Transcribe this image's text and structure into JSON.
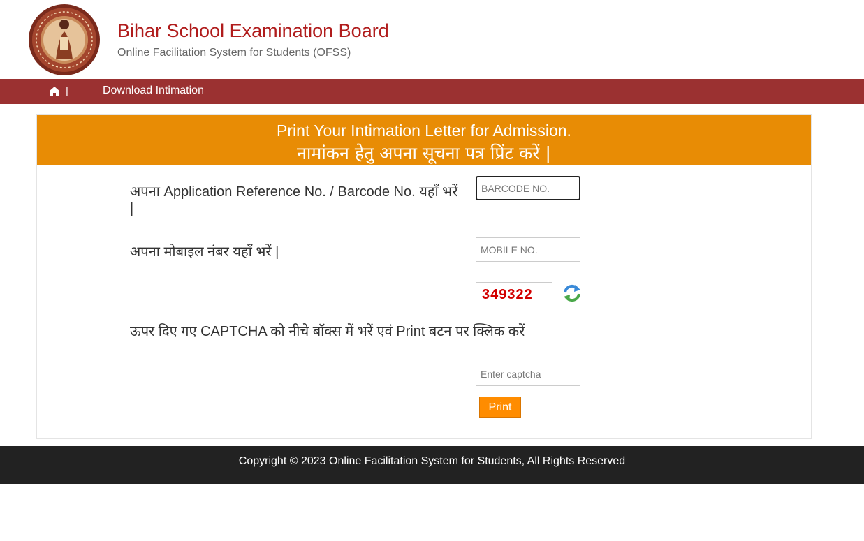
{
  "header": {
    "title": "Bihar School Examination Board",
    "subtitle": "Online Facilitation System for Students (OFSS)",
    "logo_icon": "bseb-seal-icon"
  },
  "navbar": {
    "home_icon": "home-icon",
    "separator": "|",
    "link_label": "Download Intimation",
    "bg_color": "#9b3131"
  },
  "form": {
    "heading_en": "Print Your Intimation Letter for Admission.",
    "heading_hi": "नामांकन हेतु अपना सूचना पत्र प्रिंट करें |",
    "heading_bg": "#e88c05",
    "barcode_label": "अपना Application Reference No. / Barcode No. यहाँ भरें |",
    "barcode_placeholder": "BARCODE NO.",
    "mobile_label": "अपना मोबाइल नंबर यहाँ भरें |",
    "mobile_placeholder": "MOBILE NO.",
    "captcha_code": "349322",
    "captcha_label": "ऊपर दिए गए CAPTCHA को नीचे बॉक्स में भरें एवं Print बटन पर क्लिक करें",
    "captcha_placeholder": "Enter captcha",
    "refresh_icon": "refresh-icon",
    "print_label": "Print",
    "print_color": "#ff8c00"
  },
  "footer": {
    "text": "Copyright © 2023 Online Facilitation System for Students, All Rights Reserved"
  }
}
